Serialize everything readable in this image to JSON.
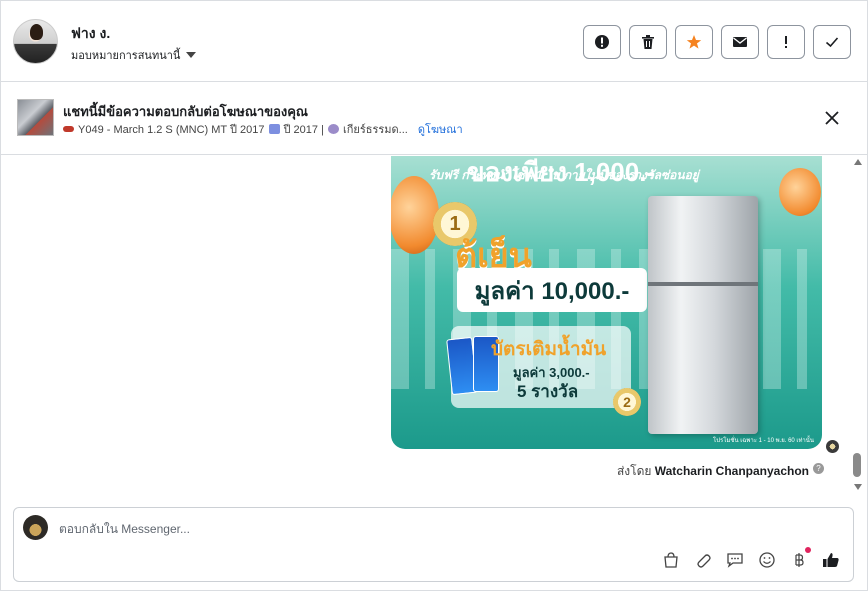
{
  "header": {
    "contact_name": "ฟาง ง.",
    "assign_label": "มอบหมายการสนทนานี้",
    "actions": [
      {
        "name": "spam-button",
        "icon": "alert-circle-icon"
      },
      {
        "name": "delete-button",
        "icon": "trash-icon"
      },
      {
        "name": "star-button",
        "icon": "star-icon",
        "color": "#f5821f"
      },
      {
        "name": "mark-unread-button",
        "icon": "envelope-icon"
      },
      {
        "name": "follow-up-button",
        "icon": "exclamation-icon"
      },
      {
        "name": "done-button",
        "icon": "check-icon"
      }
    ]
  },
  "ad": {
    "title": "แชทนี้มีข้อความตอบกลับต่อโฆษณาของคุณ",
    "subtitle": "Y049 - March 1.2 S (MNC) MT ปี 2017",
    "year_text": "ปี 2017 |",
    "gear_text": "เกียร์ธรรมด...",
    "link": "ดูโฆษณา"
  },
  "message": {
    "promo": {
      "headline": "ของเพียง 1,000.-",
      "free_text": "รับฟรี กระทงนำโชค 1 ใบ ภายในมีของรางวัลซ่อนอยู่",
      "prize1_title": "ตู้เย็น",
      "prize1_value": "มูลค่า 10,000.-",
      "prize2_title": "บัตรเติมน้ำมัน",
      "prize2_value": "มูลค่า 3,000.-",
      "prize2_count": "5 รางวัล",
      "medal1": "1",
      "medal2": "2",
      "fine_print": "โปรโมชั่น เฉพาะ 1 - 10 พ.ย. 60 เท่านั้น"
    },
    "sent_by_prefix": "ส่งโดย",
    "sent_by_name": "Watcharin Chanpanyachon"
  },
  "composer": {
    "placeholder": "ตอบกลับใน Messenger...",
    "icons": [
      "bag-icon",
      "paperclip-icon",
      "saved-reply-icon",
      "emoji-icon",
      "baht-icon",
      "like-icon"
    ]
  },
  "colors": {
    "star": "#f5821f",
    "link": "#216fdb",
    "like": "#1c1e21",
    "notif": "#e0245e"
  }
}
